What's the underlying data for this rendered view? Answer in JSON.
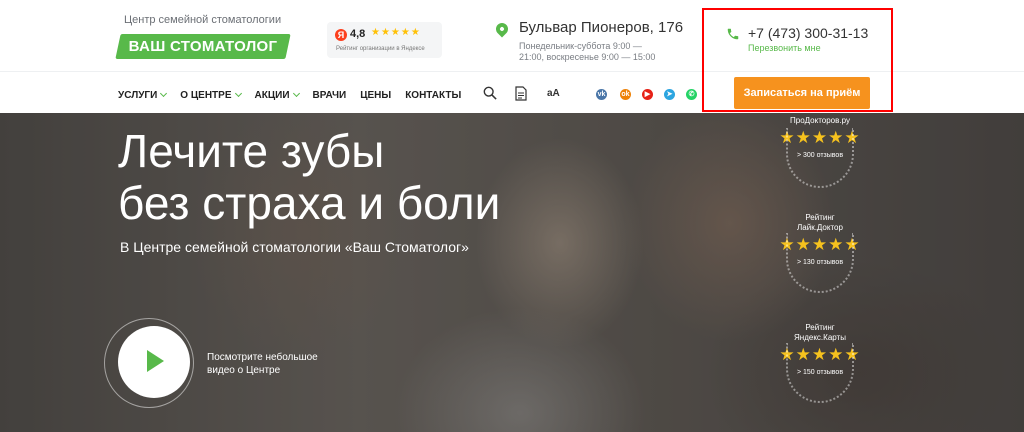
{
  "header": {
    "logo_subtitle": "Центр семейной стоматологии",
    "logo_text": "ВАШ СТОМАТОЛОГ",
    "rating": {
      "badge": "Я",
      "value": "4,8",
      "stars": "★★★★★",
      "caption": "Рейтинг организации в Яндексе"
    },
    "address": "Бульвар Пионеров, 176",
    "hours": "Понедельник-суббота 9:00 — 21:00, воскресенье 9:00 — 15:00",
    "phone": "+7 (473) 300-31-13",
    "callback": "Перезвонить мне",
    "book_button": "Записаться на приём"
  },
  "nav": {
    "items": [
      {
        "label": "УСЛУГИ"
      },
      {
        "label": "О ЦЕНТРЕ"
      },
      {
        "label": "АКЦИИ"
      },
      {
        "label": "ВРАЧИ"
      },
      {
        "label": "ЦЕНЫ"
      },
      {
        "label": "КОНТАКТЫ"
      }
    ],
    "font_toggle": "аА"
  },
  "social": [
    {
      "name": "vk",
      "glyph": "vk",
      "color": "#4a76a8"
    },
    {
      "name": "odnoklassniki",
      "glyph": "ok",
      "color": "#ee8208"
    },
    {
      "name": "youtube",
      "glyph": "▶",
      "color": "#e62117"
    },
    {
      "name": "telegram",
      "glyph": "➤",
      "color": "#2ca5e0"
    },
    {
      "name": "whatsapp",
      "glyph": "✆",
      "color": "#25d366"
    }
  ],
  "hero": {
    "headline_line1": "Лечите зубы",
    "headline_line2": "без страха и боли",
    "subline": "В Центре семейной стоматологии «Ваш Стоматолог»",
    "video_text": "Посмотрите небольшое видео о Центре"
  },
  "awards": [
    {
      "title": "ПроДокторов.ру",
      "stars": "★★★★★",
      "count": "> 300 отзывов"
    },
    {
      "title": "Рейтинг Лайк.Доктор",
      "stars": "★★★★★",
      "count": "> 130 отзывов"
    },
    {
      "title": "Рейтинг Яндекс.Карты",
      "stars": "★★★★★",
      "count": "> 150 отзывов"
    }
  ],
  "colors": {
    "brand_green": "#58b94a",
    "accent_orange": "#f6921e",
    "highlight_red": "#ff0000"
  }
}
